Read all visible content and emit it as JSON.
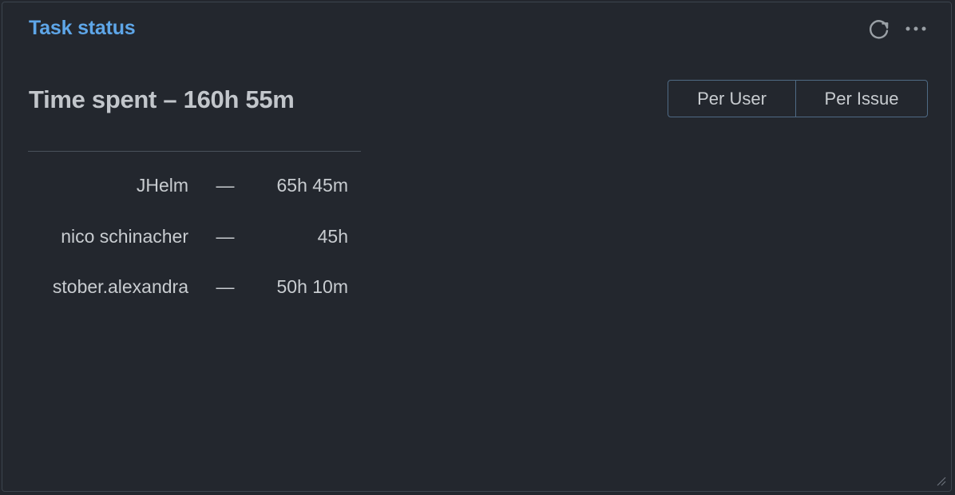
{
  "widget": {
    "title": "Task status",
    "actions": {
      "refresh_icon": "refresh-icon",
      "more_icon": "more-horizontal-icon"
    }
  },
  "summary": {
    "heading": "Time spent – 160h 55m"
  },
  "toggle": {
    "per_user": "Per User",
    "per_issue": "Per Issue",
    "selected": "Per User"
  },
  "entries": [
    {
      "name": "JHelm",
      "separator": "—",
      "time": "65h 45m"
    },
    {
      "name": "nico schinacher",
      "separator": "—",
      "time": "45h"
    },
    {
      "name": "stober.alexandra",
      "separator": "—",
      "time": "50h 10m"
    }
  ],
  "colors": {
    "background": "#23272e",
    "title": "#5ea6e8",
    "text": "#c8ccd0",
    "border": "#4f6a84"
  }
}
